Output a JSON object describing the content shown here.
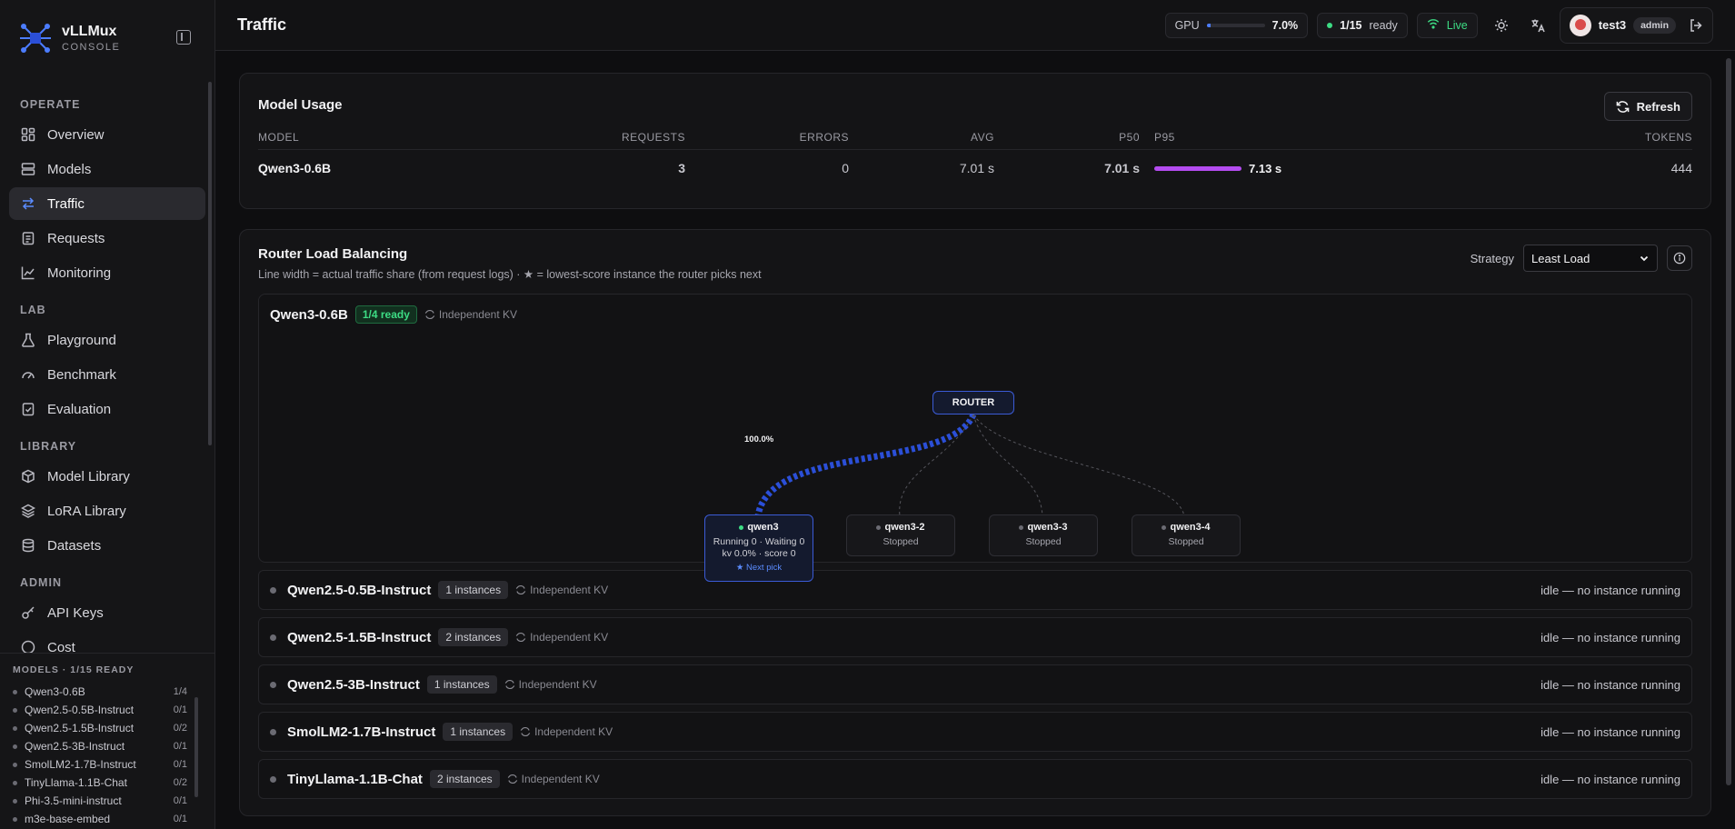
{
  "brand": {
    "name": "vLLMux",
    "sub": "CONSOLE"
  },
  "nav": {
    "sections": [
      {
        "title": "OPERATE",
        "items": [
          "Overview",
          "Models",
          "Traffic",
          "Requests",
          "Monitoring"
        ]
      },
      {
        "title": "LAB",
        "items": [
          "Playground",
          "Benchmark",
          "Evaluation"
        ]
      },
      {
        "title": "LIBRARY",
        "items": [
          "Model Library",
          "LoRA Library",
          "Datasets"
        ]
      },
      {
        "title": "ADMIN",
        "items": [
          "API Keys",
          "Cost"
        ]
      }
    ],
    "active": "Traffic"
  },
  "models_panel": {
    "title": "MODELS · 1/15 READY",
    "rows": [
      {
        "name": "Qwen3-0.6B",
        "count": "1/4"
      },
      {
        "name": "Qwen2.5-0.5B-Instruct",
        "count": "0/1"
      },
      {
        "name": "Qwen2.5-1.5B-Instruct",
        "count": "0/2"
      },
      {
        "name": "Qwen2.5-3B-Instruct",
        "count": "0/1"
      },
      {
        "name": "SmolLM2-1.7B-Instruct",
        "count": "0/1"
      },
      {
        "name": "TinyLlama-1.1B-Chat",
        "count": "0/2"
      },
      {
        "name": "Phi-3.5-mini-instruct",
        "count": "0/1"
      },
      {
        "name": "m3e-base-embed",
        "count": "0/1"
      }
    ]
  },
  "topbar": {
    "title": "Traffic",
    "gpu_label": "GPU",
    "gpu_value": "7.0%",
    "gpu_fraction": 0.07,
    "ready_count": "1/15",
    "ready_label": "ready",
    "live_label": "Live",
    "user": "test3",
    "role": "admin"
  },
  "model_usage": {
    "title": "Model Usage",
    "refresh_label": "Refresh",
    "columns": [
      "MODEL",
      "REQUESTS",
      "ERRORS",
      "AVG",
      "P50",
      "P95",
      "TOKENS"
    ],
    "rows": [
      {
        "model": "Qwen3-0.6B",
        "requests": "3",
        "errors": "0",
        "avg": "7.01 s",
        "p50": "7.01 s",
        "p95": "7.13 s",
        "tokens": "444"
      }
    ]
  },
  "router": {
    "title": "Router Load Balancing",
    "subtitle": "Line width = actual traffic share (from request logs) · ★ = lowest-score instance the router picks next",
    "strategy_label": "Strategy",
    "strategy_value": "Least Load",
    "primary_group": {
      "name": "Qwen3-0.6B",
      "ready_badge": "1/4 ready",
      "kv_label": "Independent KV",
      "router_label": "ROUTER",
      "share_label": "100.0%",
      "instances": [
        {
          "name": "qwen3",
          "line1": "Running 0 · Waiting 0",
          "line2": "kv 0.0% · score 0",
          "next": "★ Next pick"
        },
        {
          "name": "qwen3-2",
          "status": "Stopped"
        },
        {
          "name": "qwen3-3",
          "status": "Stopped"
        },
        {
          "name": "qwen3-4",
          "status": "Stopped"
        }
      ]
    },
    "groups": [
      {
        "name": "Qwen2.5-0.5B-Instruct",
        "instances": "1 instances",
        "kv": "Independent KV",
        "status": "idle — no instance running"
      },
      {
        "name": "Qwen2.5-1.5B-Instruct",
        "instances": "2 instances",
        "kv": "Independent KV",
        "status": "idle — no instance running"
      },
      {
        "name": "Qwen2.5-3B-Instruct",
        "instances": "1 instances",
        "kv": "Independent KV",
        "status": "idle — no instance running"
      },
      {
        "name": "SmolLM2-1.7B-Instruct",
        "instances": "1 instances",
        "kv": "Independent KV",
        "status": "idle — no instance running"
      },
      {
        "name": "TinyLlama-1.1B-Chat",
        "instances": "2 instances",
        "kv": "Independent KV",
        "status": "idle — no instance running"
      }
    ]
  }
}
